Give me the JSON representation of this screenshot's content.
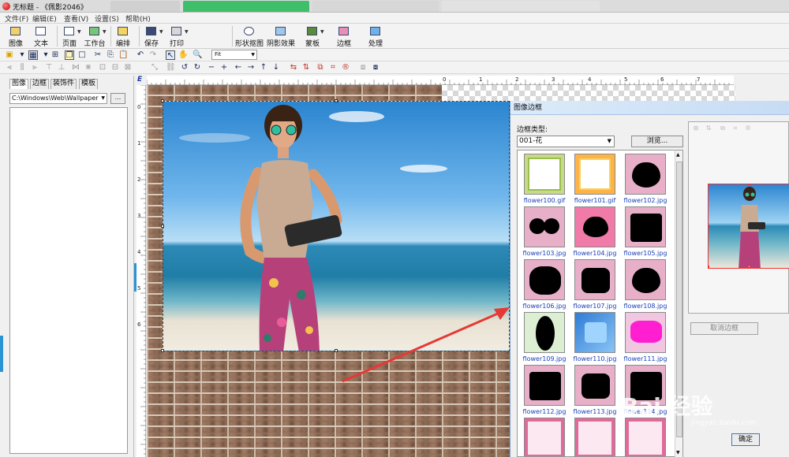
{
  "window": {
    "title": "无标题 - 《佩影2046》"
  },
  "menu": [
    "文件(F)",
    "编辑(E)",
    "查看(V)",
    "设置(S)",
    "帮助(H)"
  ],
  "toolbar_big": [
    {
      "name": "image",
      "label": "图像"
    },
    {
      "name": "text",
      "label": "文本"
    },
    {
      "name": "page",
      "label": "页面"
    },
    {
      "name": "workbench",
      "label": "工作台"
    },
    {
      "name": "layout",
      "label": "编排"
    },
    {
      "name": "save",
      "label": "保存"
    },
    {
      "name": "print",
      "label": "打印"
    },
    {
      "name": "shape-cutout",
      "label": "形状抠图"
    },
    {
      "name": "shadow-effect",
      "label": "阴影效果"
    },
    {
      "name": "mask",
      "label": "蒙板"
    },
    {
      "name": "border",
      "label": "边框"
    },
    {
      "name": "process",
      "label": "处理"
    }
  ],
  "zoom_select": {
    "value": "Fit"
  },
  "left_panel": {
    "tabs": [
      "图像",
      "边框",
      "装饰件",
      "模板"
    ],
    "active_tab": 0,
    "path": "C:\\Windows\\Web\\Wallpaper",
    "browse_button": "..."
  },
  "ruler": {
    "corner": "E",
    "top_numbers": [
      "0",
      "1",
      "2",
      "3",
      "4",
      "5",
      "6",
      "7"
    ],
    "left_numbers": [
      "0",
      "1",
      "2",
      "3",
      "4",
      "5",
      "6"
    ]
  },
  "dialog": {
    "title": "图像边框",
    "type_label": "边框类型:",
    "type_value": "001-花",
    "browse_label": "浏览...",
    "cancel_frame_label": "取消边框",
    "ok_label": "确定",
    "thumbnails": [
      {
        "file": "flower100.gif",
        "style": "flowerframe-green"
      },
      {
        "file": "flower101.gif",
        "style": "flowerframe-orange"
      },
      {
        "file": "flower102.jpg",
        "style": "heart"
      },
      {
        "file": "flower103.jpg",
        "style": "twohearts"
      },
      {
        "file": "flower104.jpg",
        "style": "heart-pink"
      },
      {
        "file": "flower105.jpg",
        "style": "rect"
      },
      {
        "file": "flower106.jpg",
        "style": "cloud"
      },
      {
        "file": "flower107.jpg",
        "style": "rect-dark"
      },
      {
        "file": "flower108.jpg",
        "style": "heart"
      },
      {
        "file": "flower109.jpg",
        "style": "oval"
      },
      {
        "file": "flower110.jpg",
        "style": "blue-frame"
      },
      {
        "file": "flower111.jpg",
        "style": "magenta"
      },
      {
        "file": "flower112.jpg",
        "style": "rect"
      },
      {
        "file": "flower113.jpg",
        "style": "rect-dark"
      },
      {
        "file": "flower114.jpg",
        "style": "rect"
      },
      {
        "file": "",
        "style": "partial"
      },
      {
        "file": "",
        "style": "partial"
      },
      {
        "file": "",
        "style": "partial"
      }
    ]
  },
  "watermark": {
    "main": "Bai 经验",
    "sub": "jingyan.baidu.com"
  },
  "colors": {
    "accent": "#2a93d5",
    "arrow": "#e53935",
    "caption": "#1a3fb8"
  }
}
